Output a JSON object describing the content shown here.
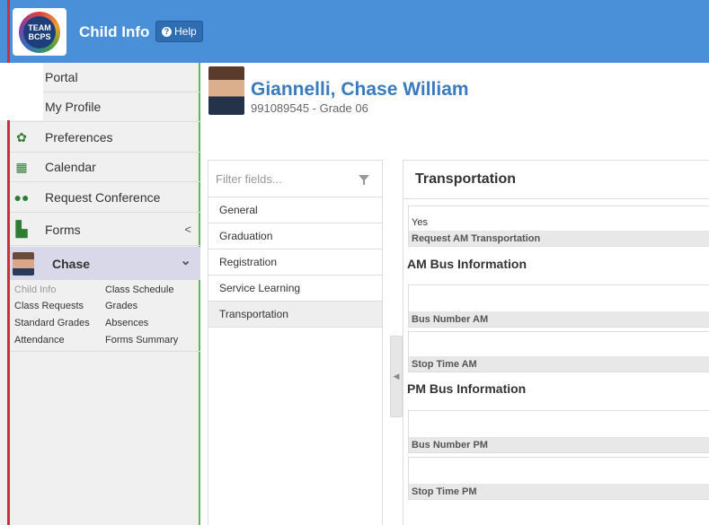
{
  "header": {
    "logo_line1": "TEAM",
    "logo_line2": "BCPS",
    "title": "Child Info",
    "help_label": "Help",
    "help_icon": "question-circle-icon"
  },
  "sidebar": {
    "items": [
      {
        "label": "Portal",
        "icon": "portal-icon"
      },
      {
        "label": "My Profile",
        "icon": "user-icon"
      },
      {
        "label": "Preferences",
        "icon": "gear-icon"
      },
      {
        "label": "Calendar",
        "icon": "calendar-icon"
      },
      {
        "label": "Request Conference",
        "icon": "users-icon"
      },
      {
        "label": "Forms",
        "icon": "file-icon",
        "chevron": "<"
      }
    ],
    "child": {
      "name": "Chase",
      "chevron": "⌄"
    },
    "sub_links": [
      {
        "label": "Child Info",
        "muted": true
      },
      {
        "label": "Class Schedule"
      },
      {
        "label": "Class Requests"
      },
      {
        "label": "Grades"
      },
      {
        "label": "Standard Grades"
      },
      {
        "label": "Absences"
      },
      {
        "label": "Attendance"
      },
      {
        "label": "Forms Summary"
      }
    ]
  },
  "student": {
    "name": "Giannelli, Chase William",
    "subtitle": "991089545 - Grade 06"
  },
  "fields": {
    "filter_placeholder": "Filter fields...",
    "items": [
      "General",
      "Graduation",
      "Registration",
      "Service Learning",
      "Transportation"
    ],
    "active": "Transportation"
  },
  "transportation": {
    "title": "Transportation",
    "request_am": {
      "value": "Yes",
      "label": "Request AM Transportation"
    },
    "am_section": "AM Bus Information",
    "bus_number_am": {
      "value": "",
      "label": "Bus Number AM"
    },
    "stop_time_am": {
      "value": "",
      "label": "Stop Time AM"
    },
    "pm_section": "PM Bus Information",
    "bus_number_pm": {
      "value": "",
      "label": "Bus Number PM"
    },
    "stop_time_pm": {
      "value": "",
      "label": "Stop Time PM"
    }
  },
  "colors": {
    "header_bg": "#4a90d9",
    "accent_red": "#c8323c",
    "sidebar_border": "#5cb85c",
    "name_blue": "#3a7abf"
  }
}
